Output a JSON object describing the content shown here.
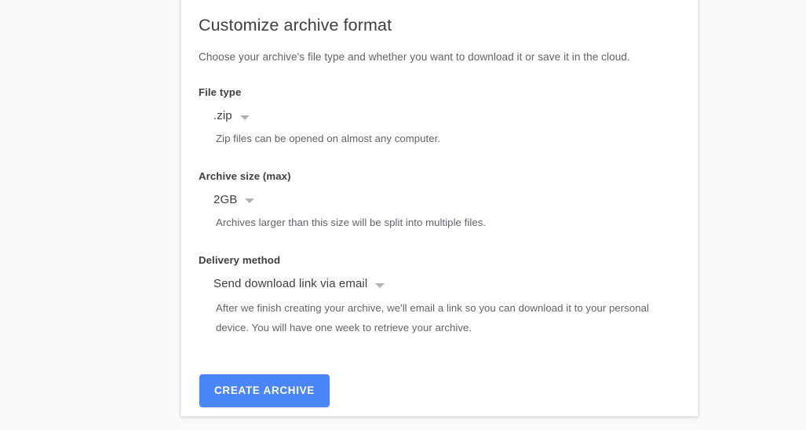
{
  "card": {
    "title": "Customize archive format",
    "subtitle": "Choose your archive's file type and whether you want to download it or save it in the cloud.",
    "sections": [
      {
        "label": "File type",
        "value": ".zip",
        "helper": "Zip files can be opened on almost any computer."
      },
      {
        "label": "Archive size (max)",
        "value": "2GB",
        "helper": "Archives larger than this size will be split into multiple files."
      },
      {
        "label": "Delivery method",
        "value": "Send download link via email",
        "helper": "After we finish creating your archive, we'll email a link so you can download it to your personal device. You will have one week to retrieve your archive."
      }
    ],
    "primary_button": "CREATE ARCHIVE"
  },
  "icons": {
    "caret": "chevron-down-icon"
  },
  "colors": {
    "accent": "#4a86f7",
    "page_background": "#fafafa",
    "card_background": "#ffffff",
    "title_text": "#3c4043",
    "helper_text": "#5f6368"
  }
}
